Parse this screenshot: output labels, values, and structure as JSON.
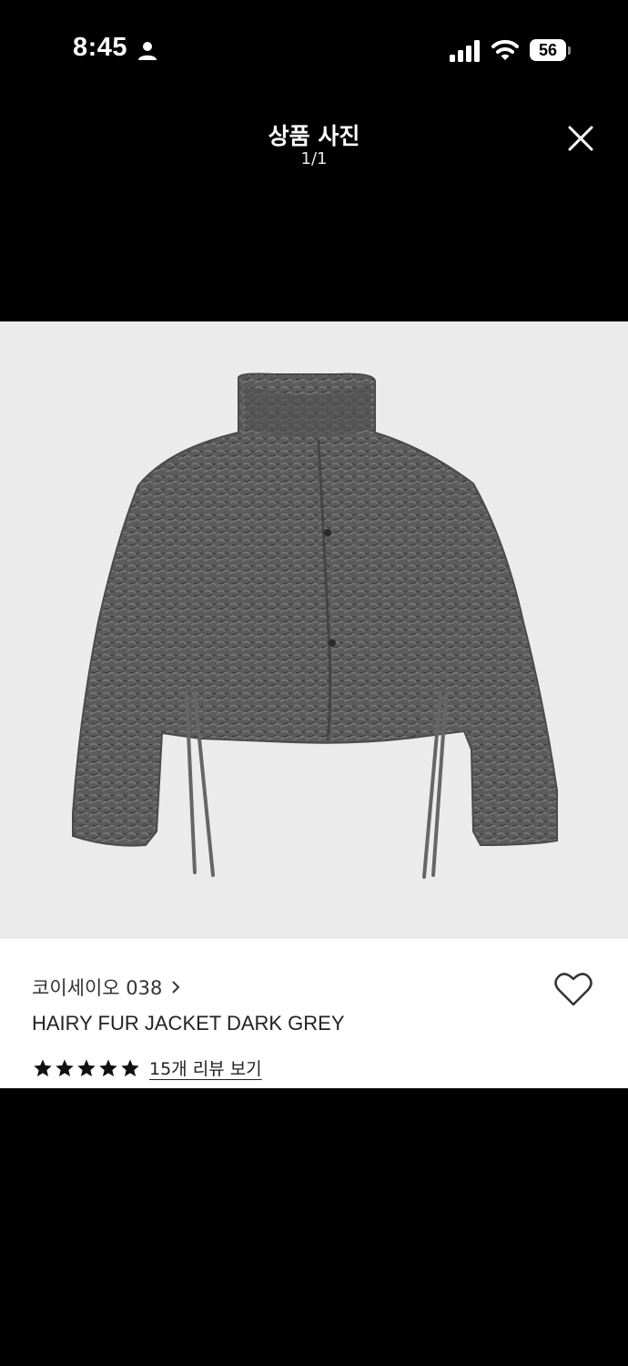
{
  "status_bar": {
    "time": "8:45",
    "battery": "56"
  },
  "viewer": {
    "title": "상품 사진",
    "page_indicator": "1/1"
  },
  "product": {
    "brand": "코이세이오 038",
    "name": "HAIRY FUR JACKET DARK GREY",
    "rating_stars": 5,
    "review_link": "15개 리뷰 보기",
    "image_color": "#585858"
  },
  "icons": [
    "person-icon",
    "signal-icon",
    "wifi-icon",
    "close-icon",
    "chevron-right-icon",
    "heart-icon",
    "star-icon"
  ]
}
